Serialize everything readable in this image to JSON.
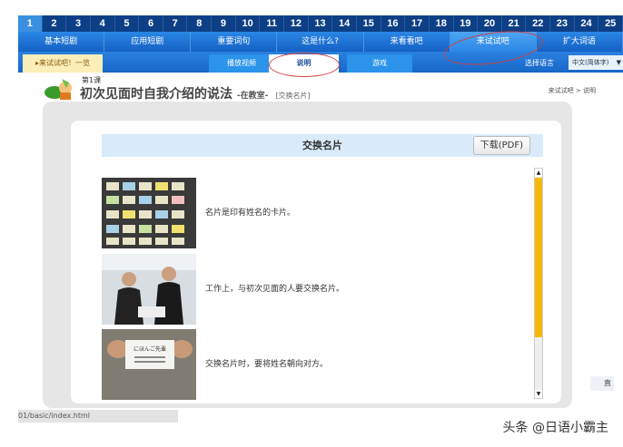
{
  "lesson_numbers": [
    "1",
    "2",
    "3",
    "4",
    "5",
    "6",
    "7",
    "8",
    "9",
    "10",
    "11",
    "12",
    "13",
    "14",
    "15",
    "16",
    "17",
    "18",
    "19",
    "20",
    "21",
    "22",
    "23",
    "24",
    "25"
  ],
  "categories": [
    "基本短剧",
    "应用短剧",
    "重要词句",
    "这是什么?",
    "来看看吧",
    "来试试吧",
    "扩大词语"
  ],
  "subtabs": {
    "overview": "▸来试试吧！一览",
    "video": "播放视频",
    "explain": "说明",
    "game": "游戏"
  },
  "language": {
    "label": "选择语言",
    "value": "中文(简体字)",
    "arrow": "▼"
  },
  "header": {
    "lesson": "第1课",
    "title": "初次见面时自我介绍的说法",
    "location": "-在教室-",
    "section": "[交换名片]",
    "breadcrumb": "来试试吧 > 说明"
  },
  "content": {
    "title": "交换名片",
    "download": "下载(PDF)",
    "rows": [
      {
        "text": "名片是印有姓名的卡片。"
      },
      {
        "text": "工作上，与初次见面的人要交换名片。"
      },
      {
        "text": "交换名片时，要将姓名朝向对方。"
      }
    ],
    "card_text": "にほんご先輩"
  },
  "status_url": "01/basic/index.html",
  "side_glyph": "直",
  "watermark": "头条 @日语小霸主"
}
